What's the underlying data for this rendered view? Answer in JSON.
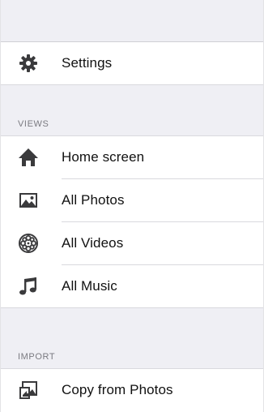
{
  "settings": {
    "label": "Settings",
    "icon": "gear-icon"
  },
  "views": {
    "header": "VIEWS",
    "items": [
      {
        "label": "Home screen",
        "icon": "home-icon"
      },
      {
        "label": "All Photos",
        "icon": "photo-icon"
      },
      {
        "label": "All Videos",
        "icon": "film-reel-icon"
      },
      {
        "label": "All Music",
        "icon": "music-note-icon"
      }
    ]
  },
  "import": {
    "header": "IMPORT",
    "items": [
      {
        "label": "Copy from Photos",
        "icon": "import-photos-icon"
      }
    ]
  },
  "colors": {
    "group_background": "#efeff4",
    "row_background": "#ffffff",
    "icon": "#3a3a3c",
    "text": "#111111",
    "section_header": "#7a7a80"
  }
}
